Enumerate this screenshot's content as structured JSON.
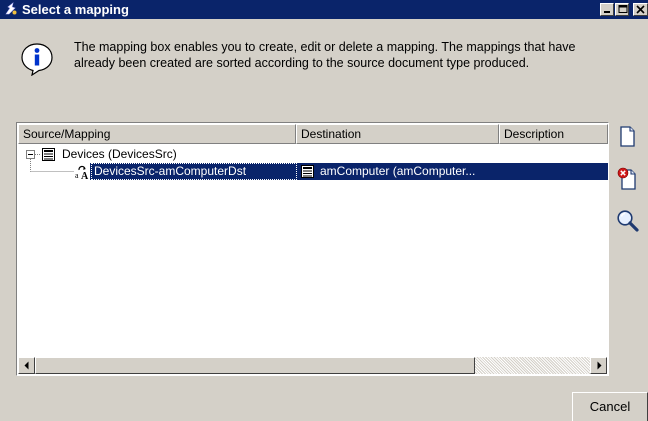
{
  "window": {
    "title": "Select a mapping",
    "controls": [
      "minimize-icon",
      "maximize-icon",
      "close-icon"
    ]
  },
  "info": {
    "icon": "info-icon",
    "line1": "The mapping box enables you to create, edit or delete a mapping. The mappings that have",
    "line2": "already been created are sorted according to the source document type produced."
  },
  "list": {
    "columns": [
      "Source/Mapping",
      "Destination",
      "Description"
    ],
    "rows": [
      {
        "level": 0,
        "expanded": true,
        "icon": "document-type-icon",
        "source": "Devices (DevicesSrc)",
        "destination": "",
        "description": ""
      },
      {
        "level": 1,
        "selected": true,
        "icon": "mapping-icon",
        "source": "DevicesSrc-amComputerDst",
        "destination_icon": "document-type-icon",
        "destination": "amComputer (amComputer...",
        "description": ""
      }
    ],
    "scrollbar": {
      "left_icon": "arrow-left-icon",
      "right_icon": "arrow-right-icon"
    }
  },
  "toolbar": {
    "buttons": [
      {
        "name": "new-mapping",
        "icon": "new-document-icon"
      },
      {
        "name": "delete-mapping",
        "icon": "delete-document-icon"
      },
      {
        "name": "view-mapping",
        "icon": "magnifier-icon"
      }
    ]
  },
  "footer": {
    "cancel_label": "Cancel"
  },
  "colors": {
    "title_bar": "#0a246a",
    "selection": "#0a246a",
    "dialog_bg": "#d4d0c8"
  }
}
